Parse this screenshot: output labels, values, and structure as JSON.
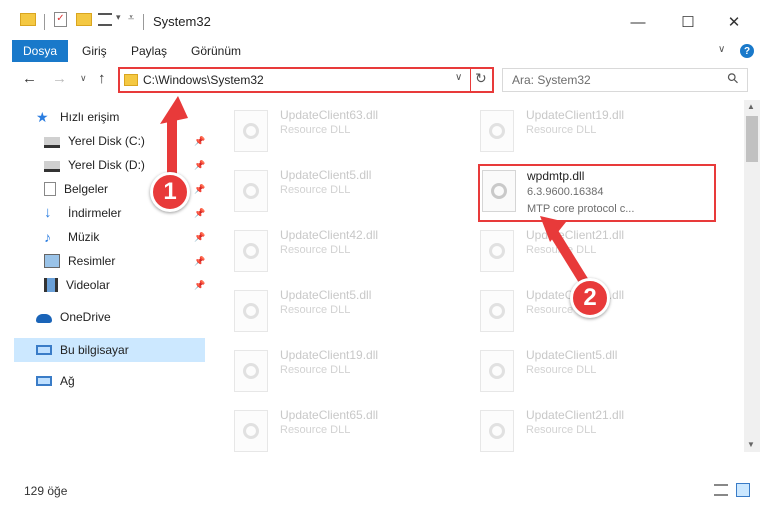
{
  "window": {
    "title": "System32",
    "minimize": "—",
    "maximize": "☐",
    "close": "✕"
  },
  "ribbon": {
    "tabs": [
      "Dosya",
      "Giriş",
      "Paylaş",
      "Görünüm"
    ],
    "help": "?"
  },
  "navigation": {
    "back": "←",
    "forward": "→",
    "recent": "∨",
    "up": "↑",
    "address": "C:\\Windows\\System32",
    "address_dropdown": "∨",
    "refresh": "↻",
    "search_placeholder": "Ara: System32",
    "search_icon": "⚲"
  },
  "sidebar": {
    "items": [
      {
        "label": "Hızlı erişim",
        "icon": "star-icon",
        "pinned": false
      },
      {
        "label": "Yerel Disk (C:)",
        "icon": "drive-icon",
        "pinned": true
      },
      {
        "label": "Yerel Disk (D:)",
        "icon": "drive-icon",
        "pinned": true
      },
      {
        "label": "Belgeler",
        "icon": "documents-icon",
        "pinned": true
      },
      {
        "label": "İndirmeler",
        "icon": "download-icon",
        "pinned": true
      },
      {
        "label": "Müzik",
        "icon": "music-icon",
        "pinned": true
      },
      {
        "label": "Resimler",
        "icon": "pictures-icon",
        "pinned": true
      },
      {
        "label": "Videolar",
        "icon": "videos-icon",
        "pinned": true
      },
      {
        "label": "OneDrive",
        "icon": "cloud-icon",
        "pinned": false
      },
      {
        "label": "Bu bilgisayar",
        "icon": "computer-icon",
        "pinned": false
      },
      {
        "label": "Ağ",
        "icon": "network-icon",
        "pinned": false
      }
    ]
  },
  "files": {
    "left": [
      {
        "name": "UpdateClient63.dll",
        "desc": "Resource DLL"
      },
      {
        "name": "UpdateClient5.dll",
        "desc": "Resource DLL"
      },
      {
        "name": "UpdateClient42.dll",
        "desc": "Resource DLL"
      },
      {
        "name": "UpdateClient5.dll",
        "desc": "Resource DLL"
      },
      {
        "name": "UpdateClient19.dll",
        "desc": "Resource DLL"
      },
      {
        "name": "UpdateClient65.dll",
        "desc": "Resource DLL"
      }
    ],
    "right": [
      {
        "name": "UpdateClient19.dll",
        "desc": "Resource DLL"
      },
      {
        "name": "UpdateClient21.dll",
        "desc": "Resource DLL"
      },
      {
        "name": "UpdateClient15.dll",
        "desc": "Resource DLL"
      },
      {
        "name": "UpdateClient5.dll",
        "desc": "Resource DLL"
      },
      {
        "name": "UpdateClient21.dll",
        "desc": "Resource DLL"
      }
    ],
    "highlighted": {
      "name": "wpdmtp.dll",
      "version": "6.3.9600.16384",
      "desc": "MTP core protocol c..."
    }
  },
  "status": {
    "count": "129 öğe"
  },
  "annotations": {
    "step1": "1",
    "step2": "2",
    "color": "#e83a3a"
  }
}
